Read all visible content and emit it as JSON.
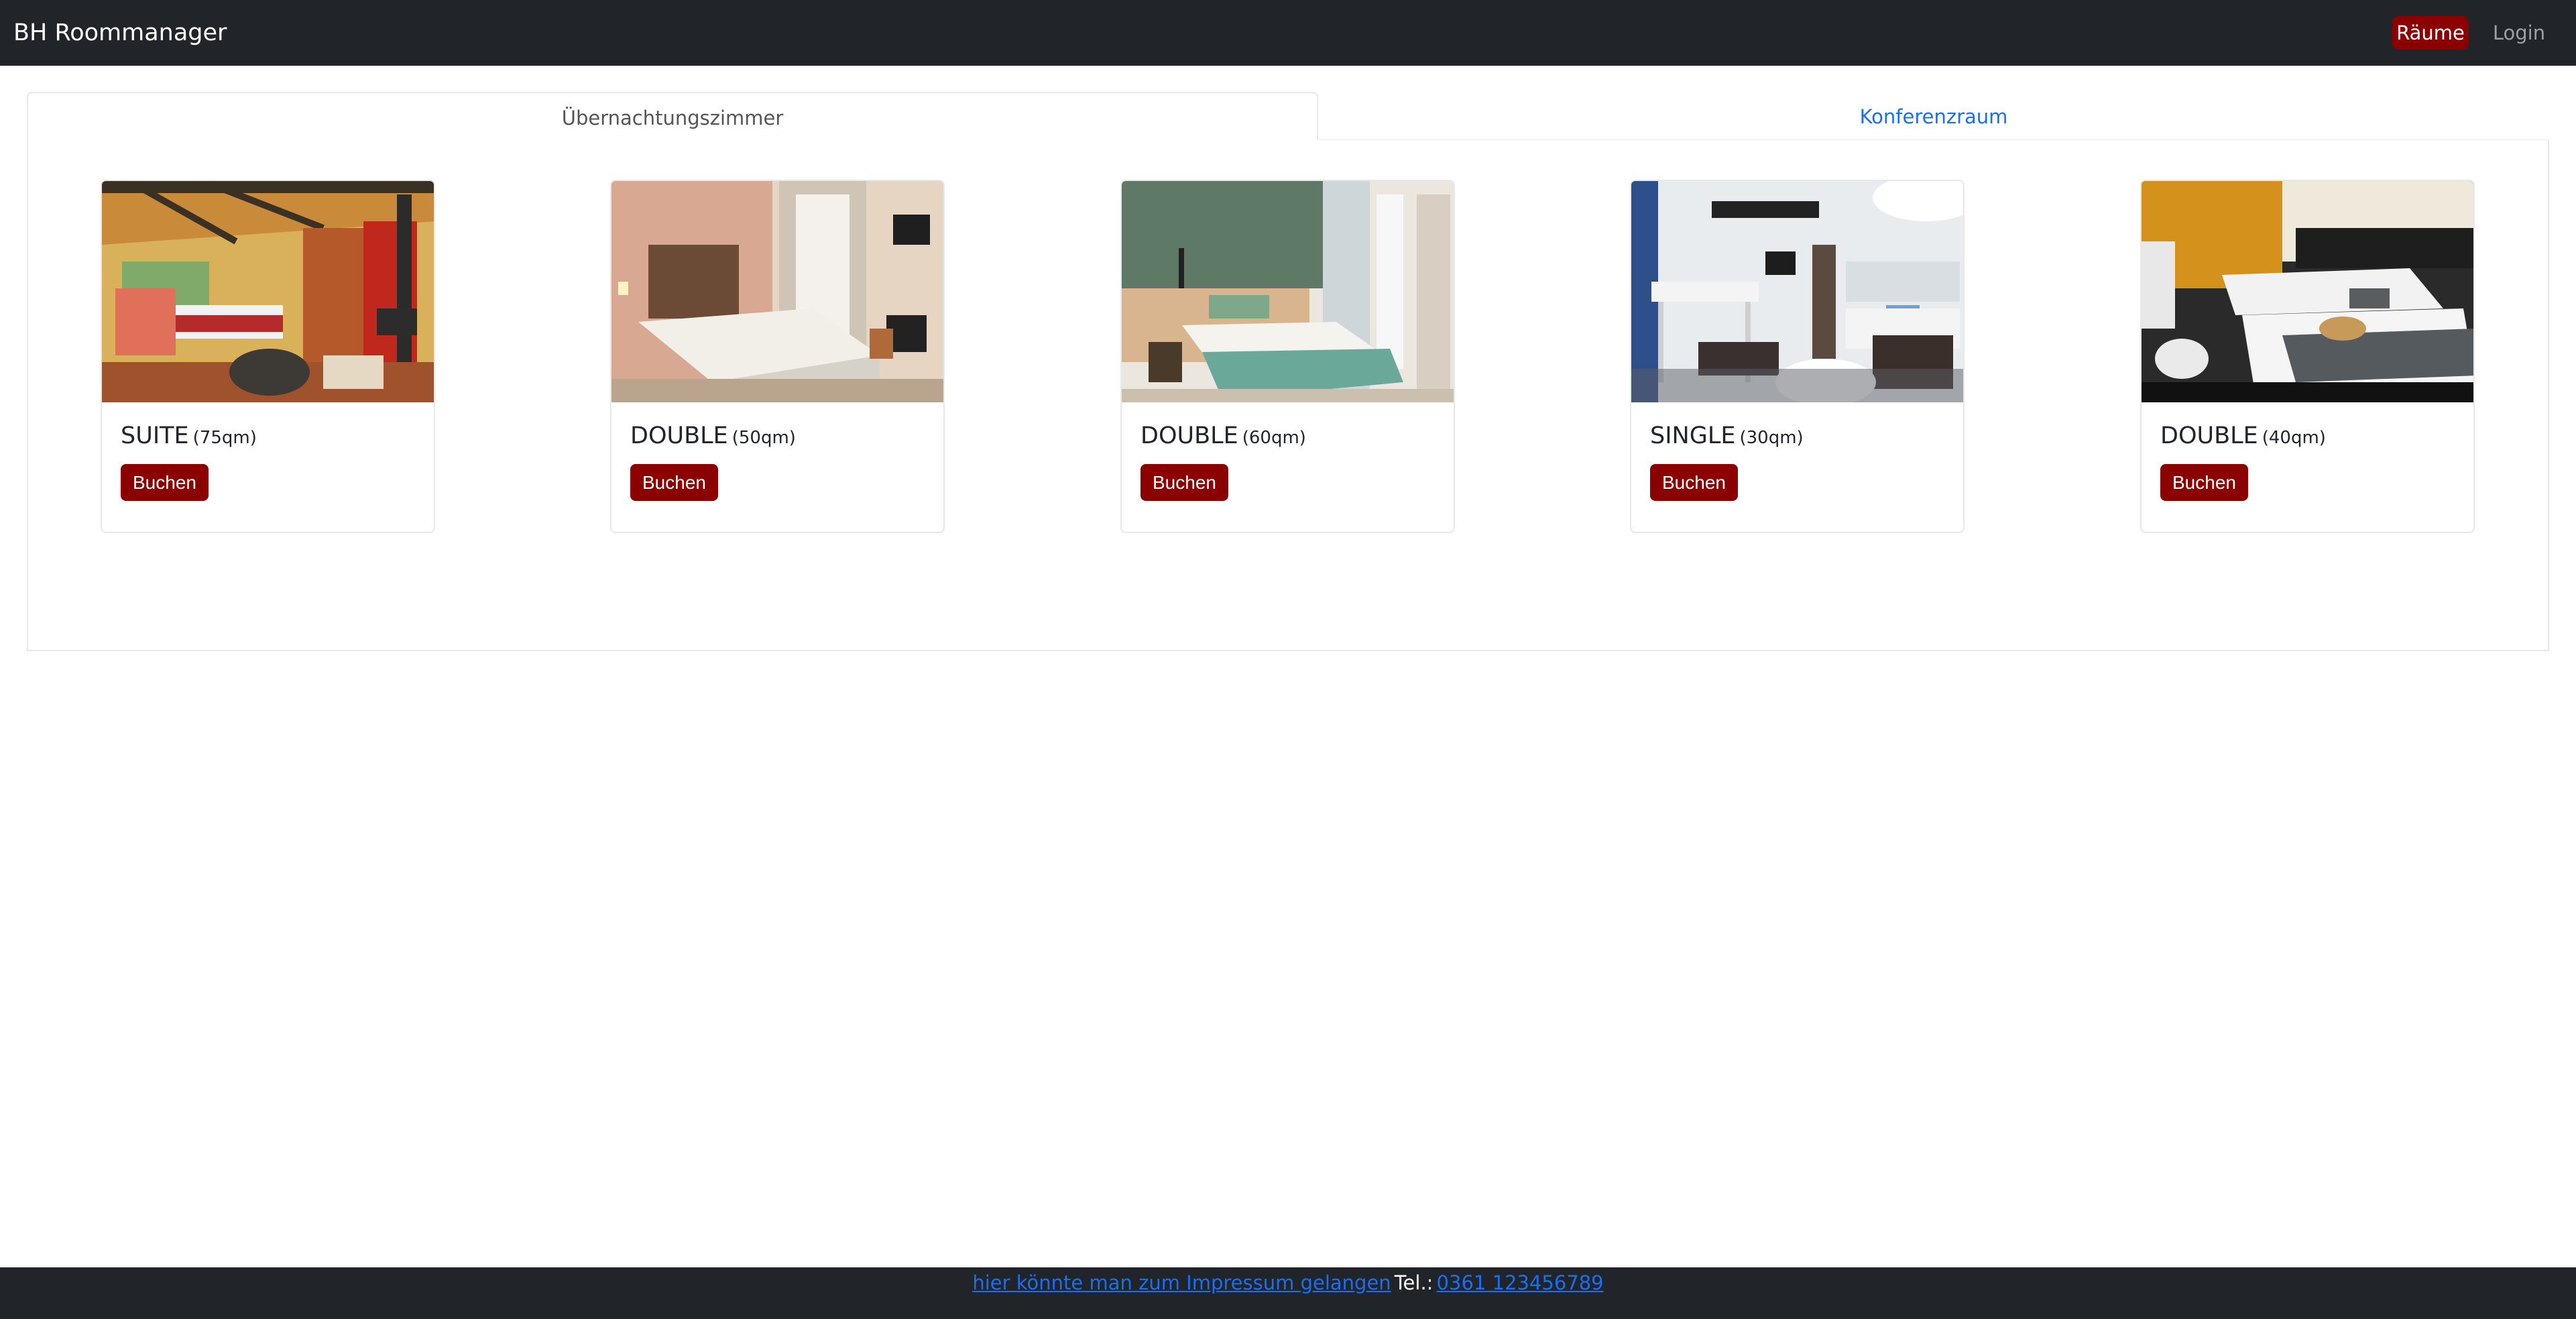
{
  "navbar": {
    "brand": "BH Roommanager",
    "items": [
      {
        "label": "Räume",
        "active": true
      },
      {
        "label": "Login",
        "active": false
      }
    ]
  },
  "tabs": [
    {
      "label": "Übernachtungszimmer",
      "active": true
    },
    {
      "label": "Konferenzraum",
      "active": false
    }
  ],
  "rooms": [
    {
      "type": "SUITE",
      "size": "(75qm)",
      "button": "Buchen"
    },
    {
      "type": "DOUBLE",
      "size": "(50qm)",
      "button": "Buchen"
    },
    {
      "type": "DOUBLE",
      "size": "(60qm)",
      "button": "Buchen"
    },
    {
      "type": "SINGLE",
      "size": "(30qm)",
      "button": "Buchen"
    },
    {
      "type": "DOUBLE",
      "size": "(40qm)",
      "button": "Buchen"
    }
  ],
  "footer": {
    "impressum_link": "hier könnte man zum Impressum gelangen",
    "tel_label": "Tel.:",
    "tel_value": "0361 123456789"
  },
  "colors": {
    "navbar_bg": "#212529",
    "accent": "#8b0000",
    "link": "#1a6ef0"
  }
}
